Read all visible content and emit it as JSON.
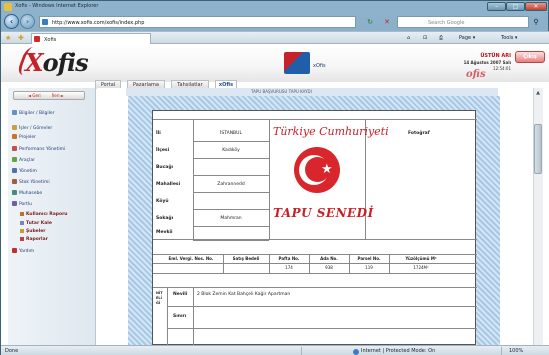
{
  "window": {
    "title": "Xofis - Windows Internet Explorer"
  },
  "nav": {
    "address": "http://www.xofis.com/xofis/index.php",
    "search_placeholder": "Search Google"
  },
  "cmdbar": {
    "tab_title": "Xofis",
    "home": "⌂",
    "feeds": "⊡",
    "print": "⎙",
    "page": "Page ▾",
    "tools": "Tools ▾"
  },
  "header": {
    "logo_x": "X",
    "logo_rest": "ofis",
    "center_name": "xOfis",
    "user": "ÜSTÜN ARI",
    "date": "14 Ağustos 2007 Salı",
    "sub": "12:54:01",
    "logout": "Çıkış",
    "logo_small": "ofis"
  },
  "top_tabs": [
    "Portal",
    "Pazarlama",
    "Tahsilatlar",
    "xOfis"
  ],
  "sidebar": {
    "back": "◄ Geri",
    "forward": "İleri ►",
    "items": [
      {
        "label": "Bilgiler / Bilgiler",
        "color": "#6a8fc2"
      },
      {
        "label": "İşler / Görevler",
        "color": "#c8a040"
      },
      {
        "label": "Projeler",
        "color": "#d07030"
      },
      {
        "label": "Performans Yönetimi",
        "color": "#c25050"
      },
      {
        "label": "Araçlar",
        "color": "#6aa040"
      },
      {
        "label": "Yönetim",
        "color": "#5070b0"
      },
      {
        "label": "Stok Yönetimi",
        "color": "#a06040"
      },
      {
        "label": "Muhasebe",
        "color": "#4a8a7a"
      },
      {
        "label": "Portlu",
        "color": "#7060a0"
      }
    ],
    "subitems": [
      {
        "label": "Kullanıcı Raporu",
        "color": "#c07030"
      },
      {
        "label": "Tutar Kale",
        "color": "#8080c0"
      },
      {
        "label": "Şubeler",
        "color": "#c0a030"
      },
      {
        "label": "Raporlar",
        "color": "#c04040"
      }
    ],
    "last_item": {
      "label": "Yardım",
      "color": "#c03030"
    }
  },
  "document": {
    "top_label": "TAPU BAŞVURUSU      TAPU KAYDI",
    "labels": [
      "İli",
      "İlçesi",
      "Bucağı",
      "Mahallesi",
      "Köyü",
      "Sokağı",
      "Mevkii"
    ],
    "values": [
      "İSTANBUL",
      "Kadıköy",
      "",
      "Zahrannedd",
      "",
      "Mahmran",
      ""
    ],
    "national_title": "Türkiye Cumhuriyeti",
    "deed_title": "TAPU SENEDİ",
    "photo_label": "Fotoğraf",
    "table_headers": [
      "Eml. Vergi. Nos. No.",
      "Satış Bedeli",
      "Pafta No.",
      "Ada No.",
      "Parsel No.",
      "Yüzölçümü M²"
    ],
    "table_values": [
      "",
      "",
      "174",
      "938",
      "119",
      "1724M²"
    ],
    "side_label": "NİTELİĞİ",
    "nitelik_rows": [
      {
        "label": "Nevili",
        "value": "2 Blok Zemin Kat Bahçeli Kağir Apartman"
      },
      {
        "label": "Sınırı",
        "value": ""
      }
    ]
  },
  "status": {
    "text": "Done",
    "zone": "Internet | Protected Mode: On",
    "zoom": "100%"
  }
}
